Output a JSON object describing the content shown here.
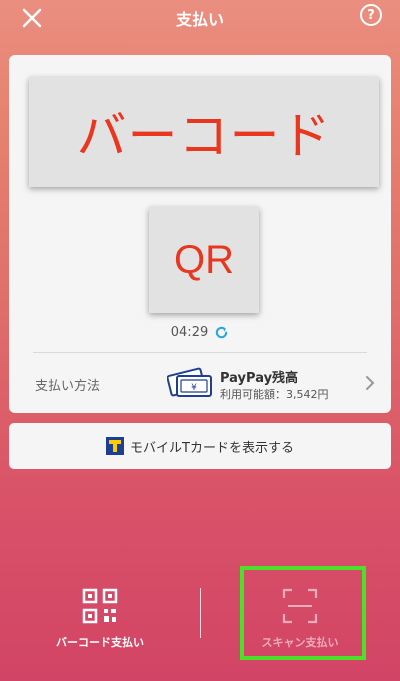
{
  "header": {
    "title": "支払い",
    "close_icon": "close-icon",
    "help_label": "?"
  },
  "card": {
    "barcode_label": "バーコード",
    "qr_label": "QR",
    "timer": "04:29",
    "payment": {
      "label": "支払い方法",
      "method_name": "PayPay残高",
      "available": "利用可能額：3,542円"
    }
  },
  "tcard_button": {
    "label": "モバイルTカードを表示する"
  },
  "bottom_tabs": [
    {
      "label": "バーコード支払い",
      "icon": "qr-code-icon",
      "active": true
    },
    {
      "label": "スキャン支払い",
      "icon": "scan-frame-icon",
      "active": false
    }
  ],
  "colors": {
    "accent_red": "#e8361f",
    "highlight_green": "#4de02a",
    "refresh_blue": "#2aa6e0"
  }
}
